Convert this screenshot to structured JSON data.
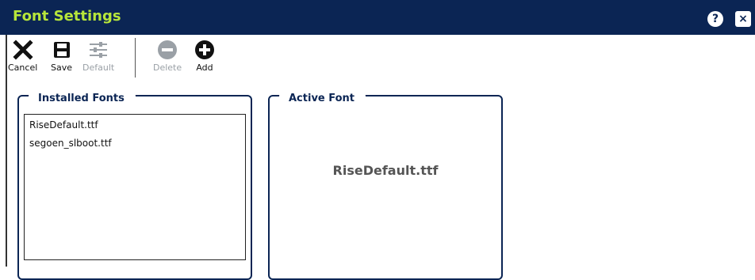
{
  "window": {
    "title": "Font Settings",
    "help_glyph": "?",
    "close_glyph": "×"
  },
  "toolbar": {
    "cancel": {
      "label": "Cancel",
      "icon": "x-icon"
    },
    "save": {
      "label": "Save",
      "icon": "floppy-disk-icon"
    },
    "default": {
      "label": "Default",
      "icon": "sliders-icon",
      "disabled": true
    },
    "delete": {
      "label": "Delete",
      "icon": "minus-circle-icon",
      "disabled": true
    },
    "add": {
      "label": "Add",
      "icon": "plus-circle-icon"
    }
  },
  "installed_fonts": {
    "title": "Installed Fonts",
    "items": [
      "RiseDefault.ttf",
      "segoen_slboot.ttf"
    ]
  },
  "active_font": {
    "title": "Active Font",
    "name": "RiseDefault.ttf"
  },
  "colors": {
    "title_bar": "#0b2554",
    "title_text": "#b7e63a",
    "disabled": "#9aa0a6"
  }
}
